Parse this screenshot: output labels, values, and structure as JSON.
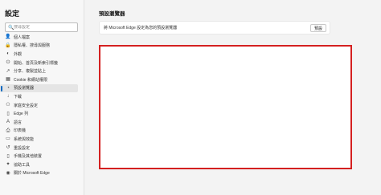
{
  "sidebar": {
    "title": "設定",
    "search_placeholder": "搜尋設定",
    "items": [
      {
        "label": "個人檔案",
        "icon": "profile-icon",
        "glyph": "👤",
        "active": false
      },
      {
        "label": "隱私權、搜尋與服務",
        "icon": "lock-icon",
        "glyph": "🔒",
        "active": false
      },
      {
        "label": "外觀",
        "icon": "palette-icon",
        "glyph": "◐",
        "active": false
      },
      {
        "label": "開始、首頁及新索引標籤",
        "icon": "power-icon",
        "glyph": "⏻",
        "active": false
      },
      {
        "label": "分享、複製並貼上",
        "icon": "share-icon",
        "glyph": "↗",
        "active": false
      },
      {
        "label": "Cookie 和網站權限",
        "icon": "cookie-icon",
        "glyph": "▦",
        "active": false
      },
      {
        "label": "預設瀏覽器",
        "icon": "browser-icon",
        "glyph": "◔",
        "active": true
      },
      {
        "label": "下載",
        "icon": "download-icon",
        "glyph": "↓",
        "active": false
      },
      {
        "label": "家庭安全設定",
        "icon": "family-icon",
        "glyph": "⚇",
        "active": false
      },
      {
        "label": "Edge 列",
        "icon": "edge-bar-icon",
        "glyph": "▯",
        "active": false
      },
      {
        "label": "語言",
        "icon": "language-icon",
        "glyph": "A",
        "active": false
      },
      {
        "label": "印表機",
        "icon": "printer-icon",
        "glyph": "⎙",
        "active": false
      },
      {
        "label": "系統與效能",
        "icon": "system-icon",
        "glyph": "▭",
        "active": false
      },
      {
        "label": "重設設定",
        "icon": "reset-icon",
        "glyph": "↺",
        "active": false
      },
      {
        "label": "手機及其他裝置",
        "icon": "phone-icon",
        "glyph": "▯",
        "active": false
      },
      {
        "label": "協助工具",
        "icon": "accessibility-icon",
        "glyph": "✦",
        "active": false
      },
      {
        "label": "關於 Microsoft Edge",
        "icon": "edge-logo-icon",
        "glyph": "◉",
        "active": false
      }
    ]
  },
  "main": {
    "title": "預設瀏覽器",
    "card_text": "將 Microsoft Edge 設定為您的預設瀏覽器",
    "card_button": "預設"
  },
  "colors": {
    "accent": "#0067c0",
    "highlight_border": "#d42020"
  }
}
